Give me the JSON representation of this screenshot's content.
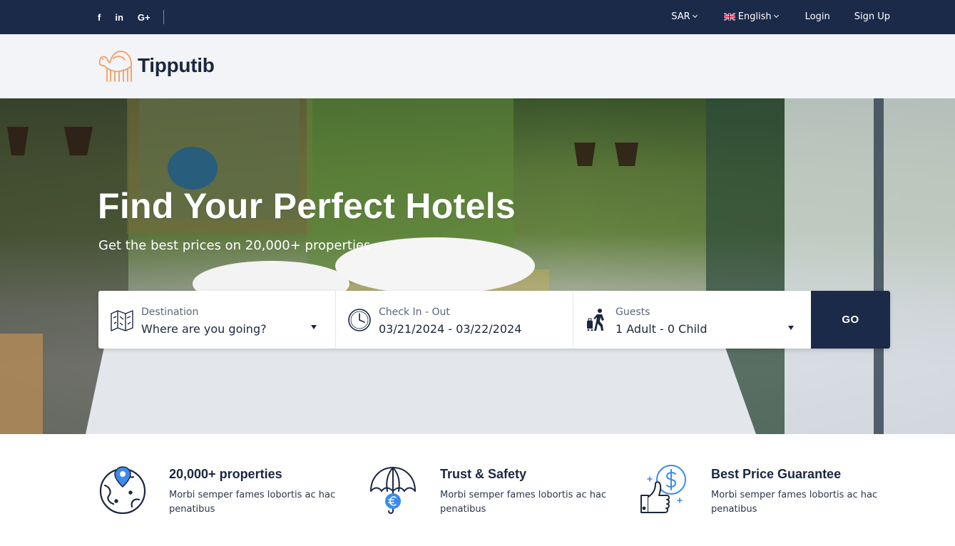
{
  "topbar": {
    "social": [
      {
        "icon": "facebook-icon",
        "glyph": "f"
      },
      {
        "icon": "linkedin-icon",
        "glyph": "in"
      },
      {
        "icon": "google-plus-icon",
        "glyph": "G+"
      }
    ],
    "currency": "SAR",
    "language": "English",
    "login": "Login",
    "signup": "Sign Up"
  },
  "header": {
    "logo_text": "Tipputib",
    "logo_color": "#f2a66b"
  },
  "hero": {
    "title": "Find Your Perfect Hotels",
    "subtitle": "Get the best prices on 20,000+ properties"
  },
  "search": {
    "destination": {
      "label": "Destination",
      "value": "Where are you going?",
      "icon": "map-icon"
    },
    "dates": {
      "label": "Check In - Out",
      "value": "03/21/2024 - 03/22/2024",
      "icon": "clock-icon"
    },
    "guests": {
      "label": "Guests",
      "value": "1 Adult - 0 Child",
      "icon": "traveler-icon"
    },
    "go_label": "GO"
  },
  "features": [
    {
      "title": "20,000+ properties",
      "text": "Morbi semper fames lobortis ac hac penatibus",
      "icon": "globe-pin-icon"
    },
    {
      "title": "Trust & Safety",
      "text": "Morbi semper fames lobortis ac hac penatibus",
      "icon": "umbrella-euro-icon"
    },
    {
      "title": "Best Price Guarantee",
      "text": "Morbi semper fames lobortis ac hac penatibus",
      "icon": "thumbs-up-dollar-icon"
    }
  ],
  "colors": {
    "navy": "#1c2a4a",
    "accent_blue": "#3b8bea",
    "logo_orange": "#f2a66b"
  }
}
